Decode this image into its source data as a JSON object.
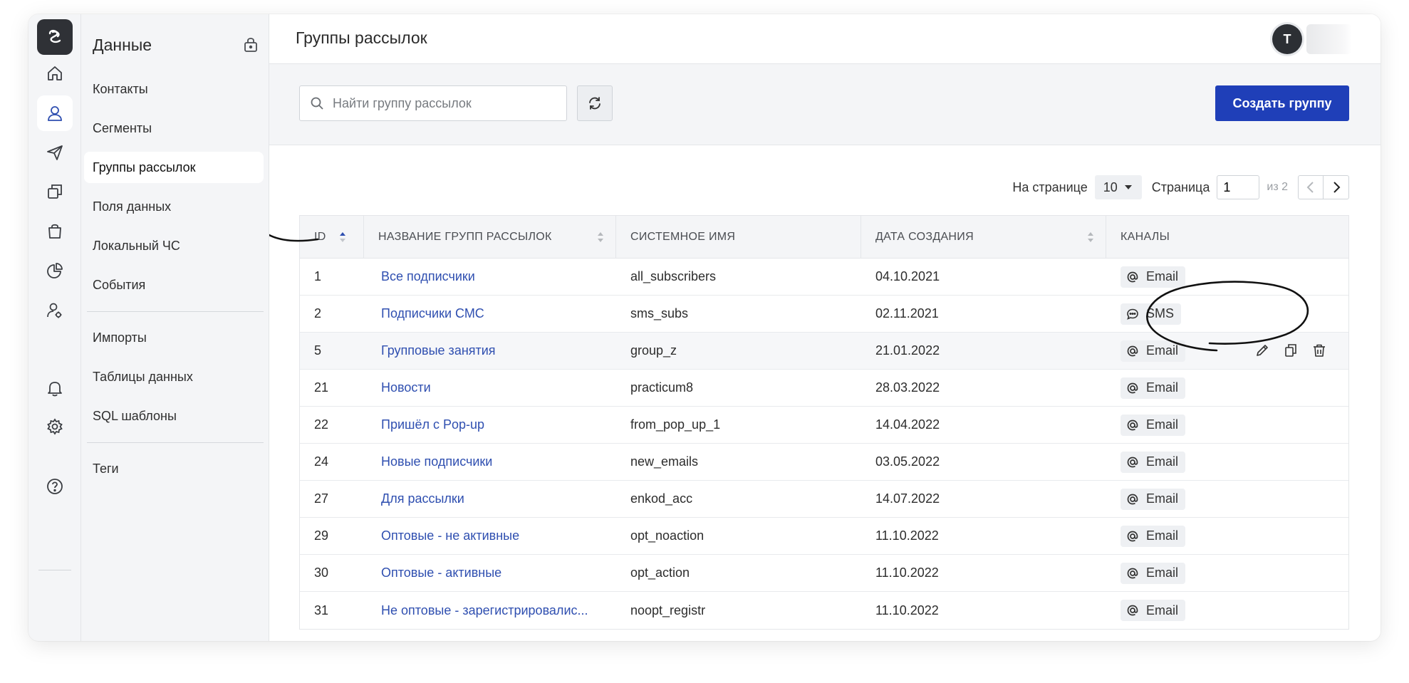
{
  "sidebar": {
    "title": "Данные",
    "items": [
      {
        "label": "Контакты"
      },
      {
        "label": "Сегменты"
      },
      {
        "label": "Группы рассылок"
      },
      {
        "label": "Поля данных"
      },
      {
        "label": "Локальный ЧС"
      },
      {
        "label": "События"
      },
      {
        "label": "Импорты"
      },
      {
        "label": "Таблицы данных"
      },
      {
        "label": "SQL шаблоны"
      },
      {
        "label": "Теги"
      }
    ],
    "active_index": 2
  },
  "header": {
    "title": "Группы рассылок",
    "avatar_letter": "T"
  },
  "toolbar": {
    "search_placeholder": "Найти группу рассылок",
    "create_label": "Создать группу"
  },
  "pager": {
    "per_page_label": "На странице",
    "per_page_value": "10",
    "page_label": "Страница",
    "page_value": "1",
    "total_label": "из 2"
  },
  "table": {
    "columns": [
      "ID",
      "НАЗВАНИЕ ГРУПП РАССЫЛОК",
      "СИСТЕМНОЕ ИМЯ",
      "ДАТА СОЗДАНИЯ",
      "КАНАЛЫ"
    ],
    "rows": [
      {
        "id": "1",
        "name": "Все подписчики",
        "system": "all_subscribers",
        "date": "04.10.2021",
        "channel": "Email"
      },
      {
        "id": "2",
        "name": "Подписчики СМС",
        "system": "sms_subs",
        "date": "02.11.2021",
        "channel": "SMS"
      },
      {
        "id": "5",
        "name": "Групповые занятия",
        "system": "group_z",
        "date": "21.01.2022",
        "channel": "Email"
      },
      {
        "id": "21",
        "name": "Новости",
        "system": "practicum8",
        "date": "28.03.2022",
        "channel": "Email"
      },
      {
        "id": "22",
        "name": "Пришёл с Pop-up",
        "system": "from_pop_up_1",
        "date": "14.04.2022",
        "channel": "Email"
      },
      {
        "id": "24",
        "name": "Новые подписчики",
        "system": "new_emails",
        "date": "03.05.2022",
        "channel": "Email"
      },
      {
        "id": "27",
        "name": "Для рассылки",
        "system": "enkod_acc",
        "date": "14.07.2022",
        "channel": "Email"
      },
      {
        "id": "29",
        "name": "Оптовые - не активные",
        "system": "opt_noaction",
        "date": "11.10.2022",
        "channel": "Email"
      },
      {
        "id": "30",
        "name": "Оптовые - активные",
        "system": "opt_action",
        "date": "11.10.2022",
        "channel": "Email"
      },
      {
        "id": "31",
        "name": "Не оптовые - зарегистрировалис...",
        "system": "noopt_registr",
        "date": "11.10.2022",
        "channel": "Email"
      }
    ],
    "hover_row_index": 2
  },
  "colors": {
    "accent": "#1f3fb8",
    "link": "#2f4fb0",
    "rail_logo": "#2f3136"
  }
}
